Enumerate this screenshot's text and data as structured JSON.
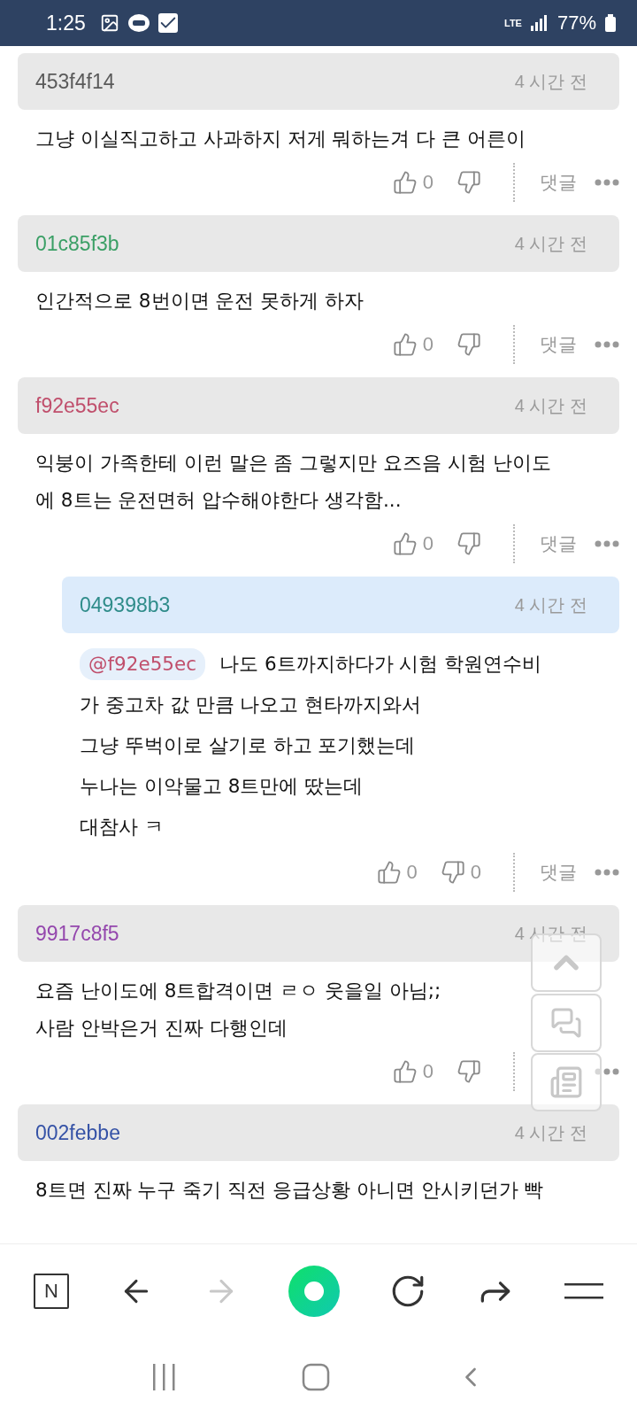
{
  "status_bar": {
    "time": "1:25",
    "network": "LTE",
    "battery": "77%"
  },
  "comments": [
    {
      "kind": "comment",
      "user": "453f4f14",
      "color": "#5a5a5a",
      "time": "4 시간 전",
      "lines": [
        "그냥 이실직고하고 사과하지 저게 뭐하는겨 다 큰 어른이"
      ],
      "likes": "0",
      "reply_label": "댓글"
    },
    {
      "kind": "comment",
      "user": "01c85f3b",
      "color": "#3a9f65",
      "time": "4 시간 전",
      "lines": [
        "인간적으로 8번이면 운전 못하게 하자"
      ],
      "likes": "0",
      "reply_label": "댓글"
    },
    {
      "kind": "comment",
      "user": "f92e55ec",
      "color": "#c04f6c",
      "time": "4 시간 전",
      "lines": [
        "익붕이 가족한테 이런 말은 좀 그렇지만 요즈음 시험 난이도",
        "에 8트는 운전면허 압수해야한다 생각함..."
      ],
      "likes": "0",
      "reply_label": "댓글"
    },
    {
      "kind": "reply",
      "user": "049398b3",
      "color": "#2f8c8a",
      "time": "4 시간 전",
      "mention": "@f92e55ec",
      "lines": [
        "나도 6트까지하다가 시험 학원연수비",
        "가 중고차 값 만큼 나오고 현타까지와서",
        "그냥 뚜벅이로 살기로 하고 포기했는데",
        "누나는 이악물고 8트만에 땄는데",
        "대참사 ㅋ"
      ],
      "likes": "0",
      "dislikes": "0",
      "reply_label": "댓글"
    },
    {
      "kind": "comment",
      "user": "9917c8f5",
      "color": "#9447ad",
      "time": "4 시간 전",
      "lines": [
        "요즘 난이도에 8트합격이면 ㄹㅇ 웃을일 아님;;",
        "사람 안박은거 진짜 다행인데"
      ],
      "likes": "0"
    },
    {
      "kind": "comment",
      "user": "002febbe",
      "color": "#3552a6",
      "time": "4 시간 전",
      "lines": [
        "8트면 진짜 누구 죽기 직전 응급상황 아니면 안시키던가 빡"
      ]
    }
  ],
  "toolbar": {
    "logo": "N",
    "forward_disabled": true
  }
}
